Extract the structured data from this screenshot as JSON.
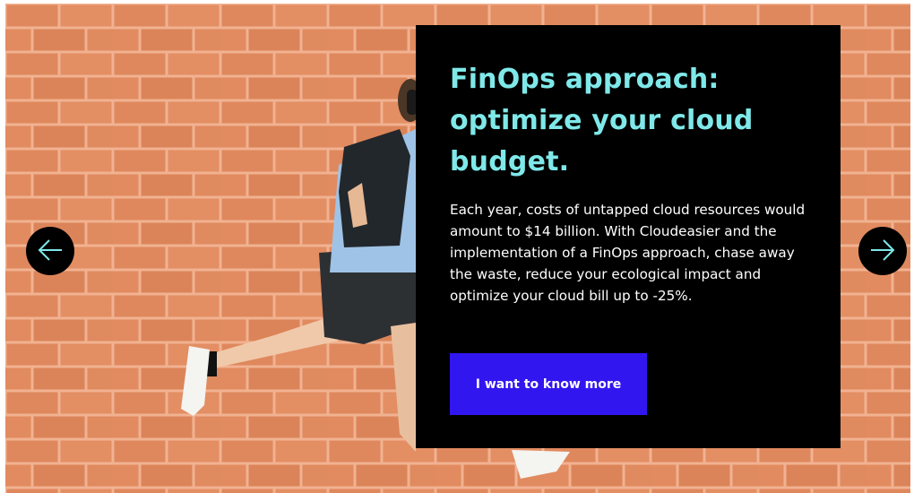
{
  "slide": {
    "title": "FinOps approach: optimize your cloud budget.",
    "body": "Each year, costs of untapped cloud resources would amount to $14 billion. With Cloudeasier and the implementation of a FinOps approach, chase away the waste, reduce your ecological impact and optimize your cloud bill up to -25%.",
    "cta_label": "I want to know more"
  },
  "navigation": {
    "prev_icon": "arrow-left-icon",
    "next_icon": "arrow-right-icon"
  },
  "colors": {
    "title": "#7fe8e9",
    "card_background": "#000000",
    "cta_background": "#3216f0",
    "arrow_stroke": "#7fe8e9",
    "brick": "#e0895f",
    "mortar": "#f0b08e"
  }
}
